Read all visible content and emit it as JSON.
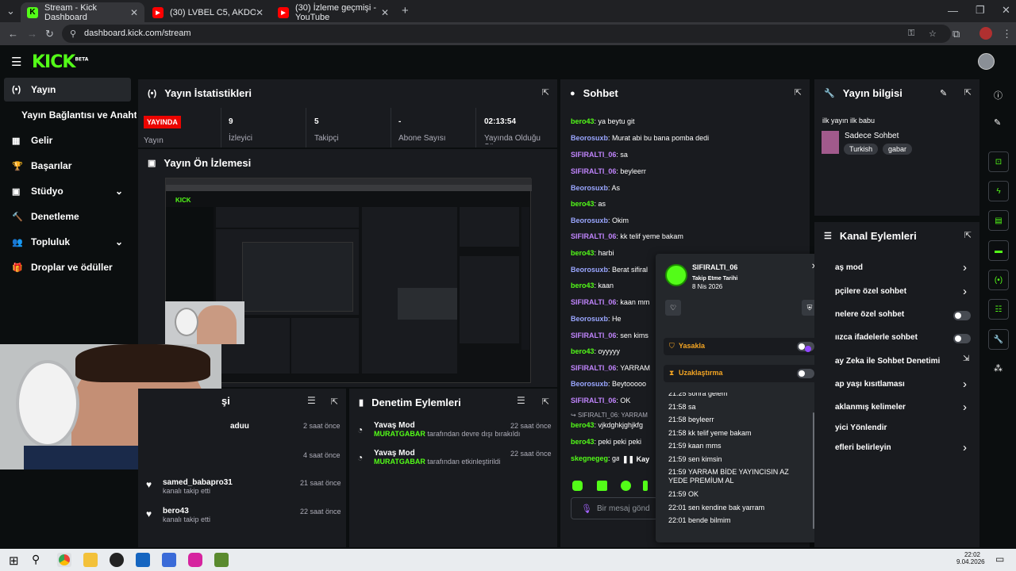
{
  "browser": {
    "tabs": [
      {
        "title": "Stream - Kick Dashboard",
        "color": "#53fc18"
      },
      {
        "title": "(30) LVBEL C5, AKDO - PEKİ PEK",
        "color": "#ff0000"
      },
      {
        "title": "(30) İzleme geçmişi - YouTube",
        "color": "#ff0000"
      }
    ],
    "url": "dashboard.kick.com/stream"
  },
  "header": {
    "logo": "KICK",
    "logo_sup": "BETA"
  },
  "sidebar": {
    "items": [
      {
        "label": "Yayın",
        "icon": "(•)"
      },
      {
        "label": "Yayın Bağlantısı ve Anahtarı",
        "icon": ""
      },
      {
        "label": "Gelir",
        "icon": "▦"
      },
      {
        "label": "Başarılar",
        "icon": "🏆"
      },
      {
        "label": "Stüdyo",
        "icon": "▣"
      },
      {
        "label": "Denetleme",
        "icon": "🔨"
      },
      {
        "label": "Topluluk",
        "icon": "👥"
      },
      {
        "label": "Droplar ve ödüller",
        "icon": "🎁"
      }
    ]
  },
  "stats": {
    "title": "Yayın İstatistikleri",
    "live_badge": "YAYINDA",
    "live_label": "Yayın",
    "viewers_value": "9",
    "viewers_label": "İzleyici",
    "followers_value": "5",
    "followers_label": "Takipçi",
    "subs_value": "-",
    "subs_label": "Abone Sayısı",
    "uptime_value": "02:13:54",
    "uptime_label": "Yayında Olduğu Süre"
  },
  "preview": {
    "title": "Yayın Ön İzlemesi"
  },
  "activity": {
    "title_suffix": "şi",
    "items": [
      {
        "name": "aduu",
        "text": "",
        "time": "2 saat önce"
      },
      {
        "name": "",
        "text": "",
        "time": "4 saat önce"
      },
      {
        "name": "samed_babapro31",
        "text": "kanalı takip etti",
        "time": "21 saat önce"
      },
      {
        "name": "bero43",
        "text": "kanalı takip etti",
        "time": "22 saat önce"
      }
    ]
  },
  "moderation": {
    "title": "Denetim Eylemleri",
    "items": [
      {
        "title": "Yavaş Mod",
        "user": "MURATGABAR",
        "text": "tarafından devre dışı bırakıldı",
        "time": "22 saat önce"
      },
      {
        "title": "Yavaş Mod",
        "user": "MURATGABAR",
        "text": "tarafından etkinleştirildi",
        "time": "22 saat önce"
      }
    ]
  },
  "chat": {
    "title": "Sohbet",
    "messages": [
      {
        "user": "bero43",
        "text": ": ya beytu git",
        "c": "u-g"
      },
      {
        "user": "Beorosuxb",
        "text": ": Murat abi bu bana pomba dedi",
        "c": "u-b"
      },
      {
        "user": "SIFIRALTI_06",
        "text": ": sa",
        "c": "u-p"
      },
      {
        "user": "SIFIRALTI_06",
        "text": ": beyleerr",
        "c": "u-p"
      },
      {
        "user": "Beorosuxb",
        "text": ": As",
        "c": "u-b"
      },
      {
        "user": "bero43",
        "text": ": as",
        "c": "u-g"
      },
      {
        "user": "Beorosuxb",
        "text": ": Okim",
        "c": "u-b"
      },
      {
        "user": "SIFIRALTI_06",
        "text": ": kk telif yeme bakam",
        "c": "u-p"
      },
      {
        "user": "bero43",
        "text": ": harbi",
        "c": "u-g"
      },
      {
        "user": "Beorosuxb",
        "text": ": Berat sifiral",
        "c": "u-b"
      },
      {
        "user": "bero43",
        "text": ": kaan",
        "c": "u-g"
      },
      {
        "user": "SIFIRALTI_06",
        "text": ": kaan mm",
        "c": "u-p"
      },
      {
        "user": "Beorosuxb",
        "text": ": He",
        "c": "u-b"
      },
      {
        "user": "SIFIRALTI_06",
        "text": ": sen kims",
        "c": "u-p"
      },
      {
        "user": "bero43",
        "text": ": oyyyyy",
        "c": "u-g"
      },
      {
        "user": "SIFIRALTI_06",
        "text": ": YARRAM",
        "c": "u-p"
      },
      {
        "user": "Beorosuxb",
        "text": ": Beytooooo",
        "c": "u-b"
      },
      {
        "user": "SIFIRALTI_06",
        "text": ": OK",
        "c": "u-p"
      }
    ],
    "reply_hint": "SIFIRALTI_06: YARRAM",
    "after_reply": [
      {
        "user": "bero43",
        "text": ": vjkdghkjghjkfg",
        "c": "u-g"
      },
      {
        "user": "bero43",
        "text": ": peki peki peki",
        "c": "u-g"
      },
      {
        "user": "skegnegeg",
        "text": ": ga",
        "c": "u-g"
      }
    ],
    "paused": "Kay",
    "input_placeholder": "Bir mesaj gönd"
  },
  "user_card": {
    "username": "SIFIRALTI_06",
    "follow_label": "Takip Etme Tarihi",
    "follow_date": "8 Nis 2026",
    "ban_label": "Yasakla",
    "timeout_label": "Uzaklaştırma",
    "history": [
      "21:25 sonra gelem",
      "21:58 sa",
      "21:58 beyleerr",
      "21:58 kk telif yeme bakam",
      "21:59 kaan mms",
      "21:59 sen kimsin",
      "21:59 YARRAM BİDE YAYINCISIN AZ YEDE PREMİUM AL",
      "21:59 OK",
      "22:01 sen kendine bak yarram",
      "22:01 bende bilmim"
    ]
  },
  "stream_info": {
    "title": "Yayın bilgisi",
    "stream_title": "ilk yayın ilk babu",
    "category": "Sadece Sohbet",
    "tags": [
      "Turkish",
      "gabar"
    ]
  },
  "channel_actions": {
    "title": "Kanal Eylemleri",
    "items": [
      "aş mod",
      "pçilere özel sohbet",
      "nelere özel sohbet",
      "ıızca ifadelerle sohbet",
      "ay Zeka ile Sohbet Denetimi",
      "ap yaşı kısıtlaması",
      "aklanmış kelimeler",
      "yici Yönlendir",
      "efleri belirleyin"
    ]
  },
  "taskbar": {
    "time": "22:02",
    "date": "9.04.2026"
  }
}
